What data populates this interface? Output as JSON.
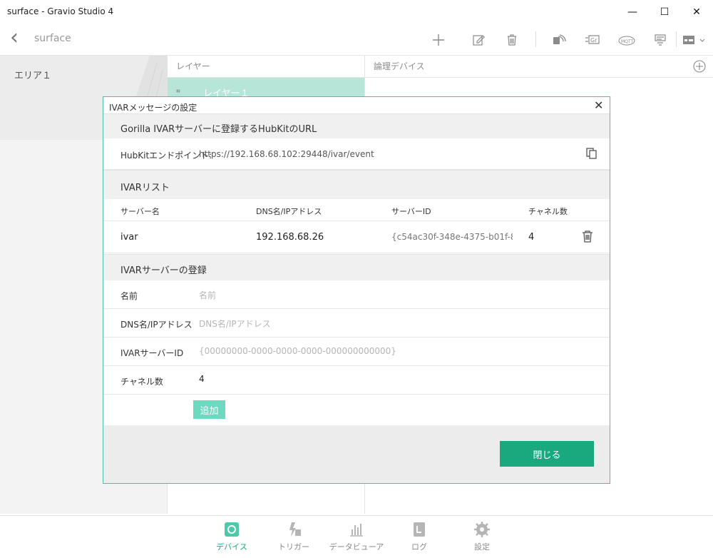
{
  "window": {
    "title": "surface - Gravio Studio 4",
    "minimize": "—",
    "maximize": "☐",
    "close": "✕"
  },
  "appbar": {
    "back": "‹",
    "page_title": "surface"
  },
  "left": {
    "area_name": "エリア１"
  },
  "layers": {
    "header": "レイヤー",
    "item": "レイヤー１"
  },
  "logic": {
    "header": "論理デバイス"
  },
  "nav": [
    {
      "label": "デバイス",
      "icon": "gear-device-icon"
    },
    {
      "label": "トリガー",
      "icon": "trigger-icon"
    },
    {
      "label": "データビューア",
      "icon": "chart-icon"
    },
    {
      "label": "ログ",
      "icon": "log-icon"
    },
    {
      "label": "設定",
      "icon": "settings-icon"
    }
  ],
  "dialog": {
    "title": "IVARメッセージの設定",
    "section_url": "Gorilla IVARサーバーに登録するHubKitのURL",
    "endpoint_label": "HubKitエンドポイント:",
    "endpoint_value": "https://192.168.68.102:29448/ivar/event",
    "section_list": "IVARリスト",
    "columns": [
      "サーバー名",
      "DNS名/IPアドレス",
      "サーバーID",
      "チャネル数"
    ],
    "servers": [
      {
        "name": "ivar",
        "dns": "192.168.68.26",
        "id": "{c54ac30f-348e-4375-b01f-8",
        "channels": "4"
      }
    ],
    "section_register": "IVARサーバーの登録",
    "form": {
      "name_label": "名前",
      "name_placeholder": "名前",
      "dns_label": "DNS名/IPアドレス",
      "dns_placeholder": "DNS名/IPアドレス",
      "id_label": "IVARサーバーID",
      "id_placeholder": "{00000000-0000-0000-0000-000000000000}",
      "channel_label": "チャネル数",
      "channel_value": "4"
    },
    "add_button": "追加",
    "close_button": "閉じる"
  },
  "colors": {
    "accent": "#1aa97f",
    "accent_light": "#6fd8c0",
    "border": "#4dbfa6",
    "layer_bg": "#b7e6d8"
  }
}
